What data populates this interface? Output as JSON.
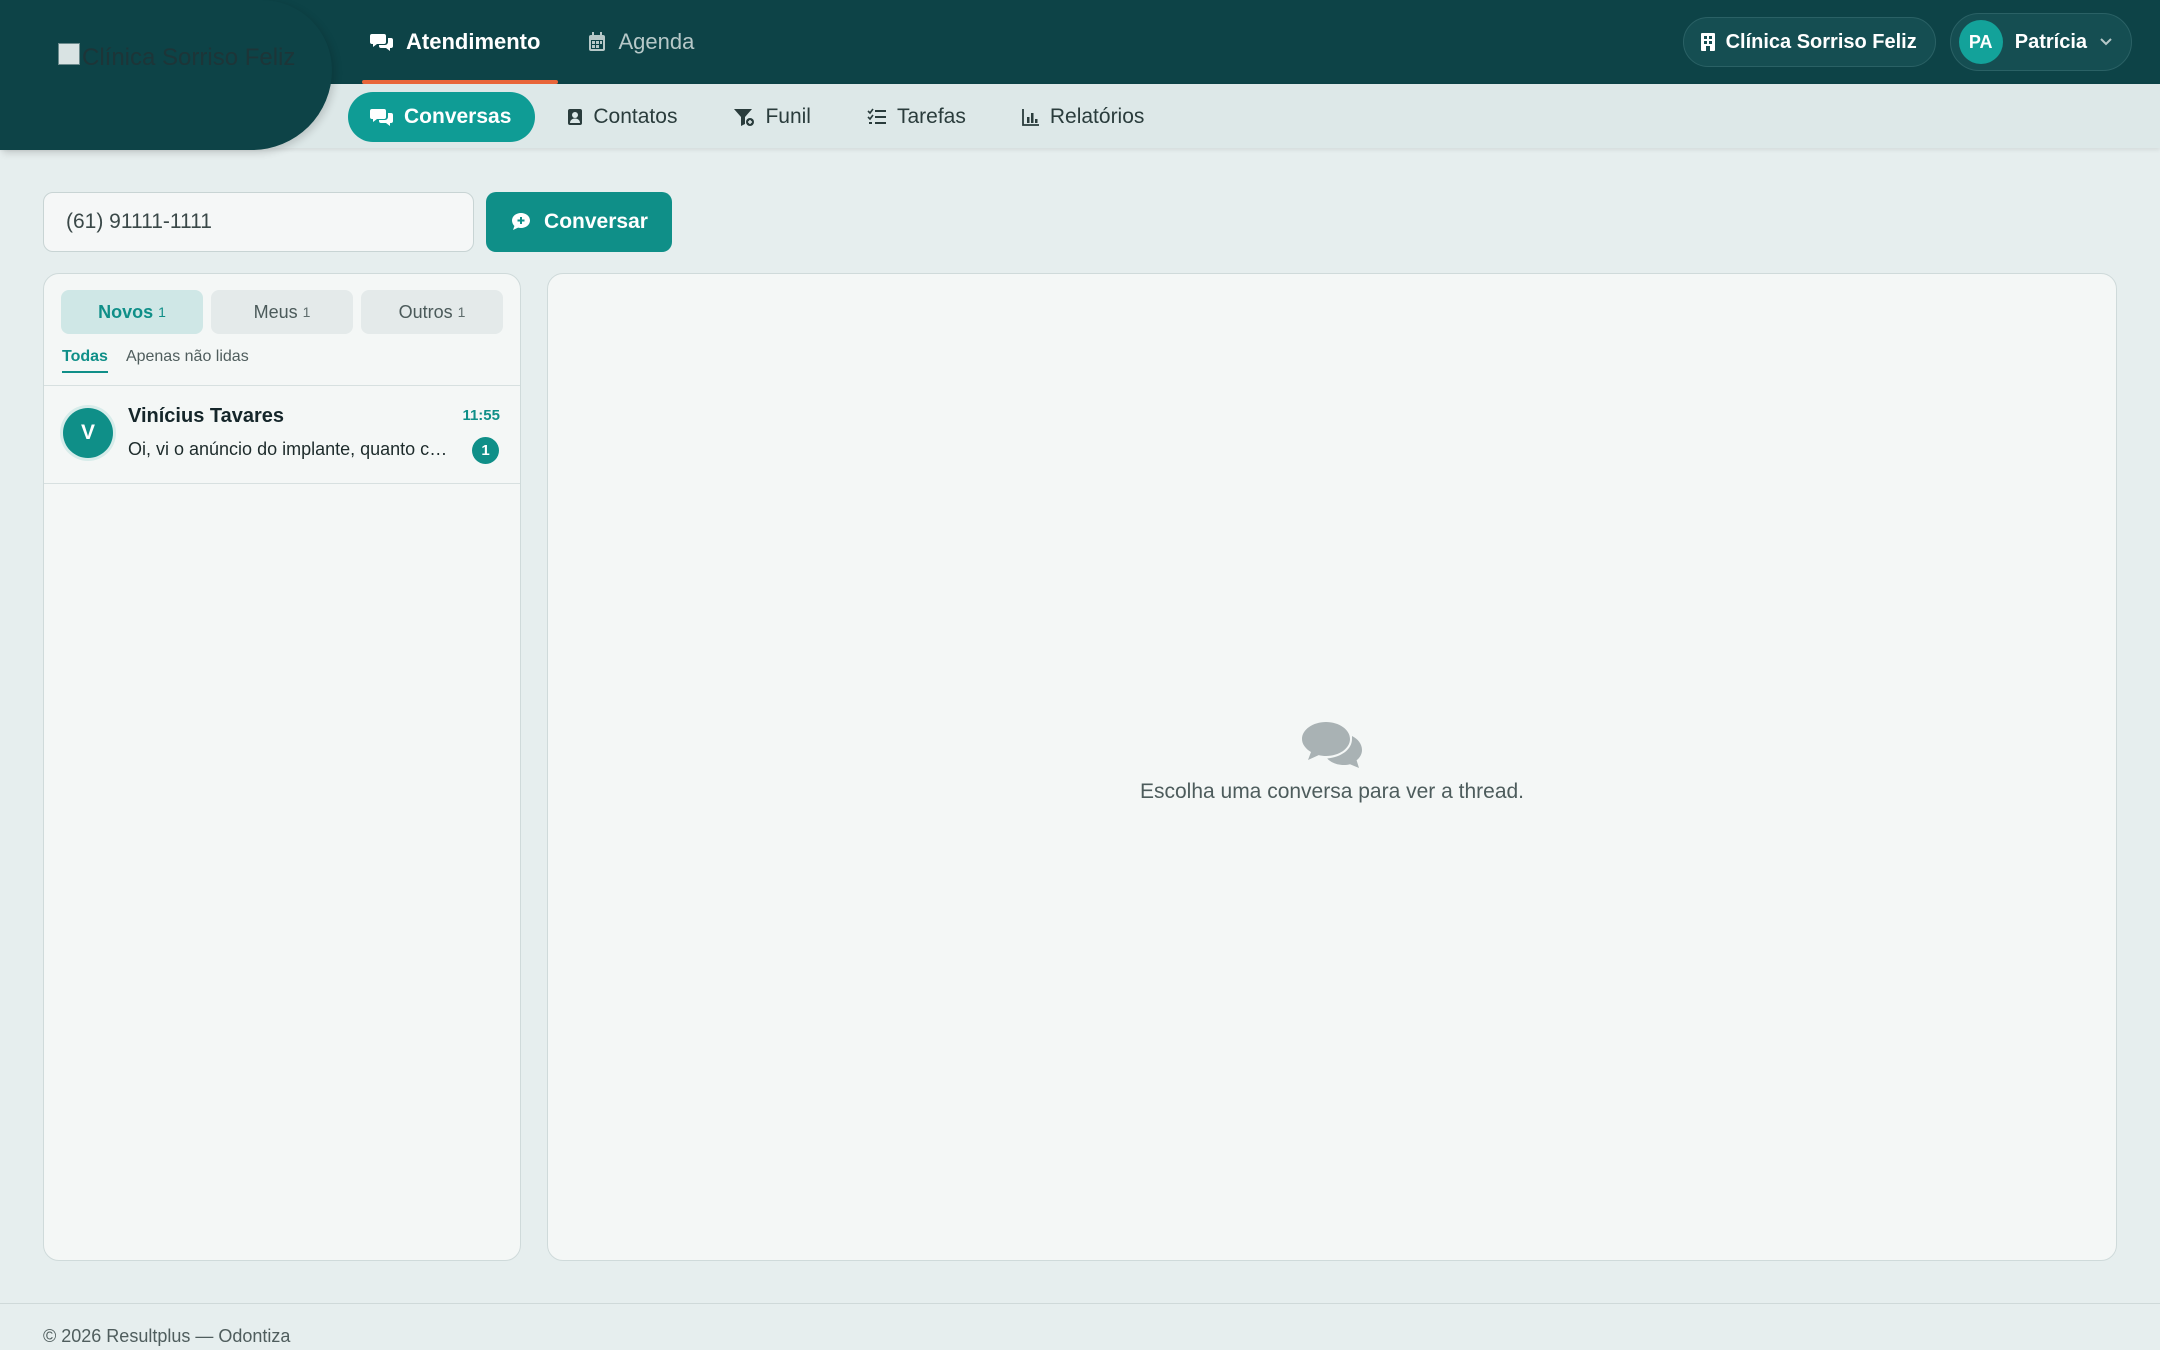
{
  "brand": {
    "logo_alt": "Clínica Sorriso Feliz"
  },
  "main_nav": {
    "items": [
      {
        "label": "Atendimento",
        "icon": "chat-bubbles-icon",
        "active": true
      },
      {
        "label": "Agenda",
        "icon": "calendar-icon",
        "active": false
      }
    ]
  },
  "header": {
    "clinic_name": "Clínica Sorriso Feliz",
    "clinic_icon": "building-icon",
    "user_initials": "PA",
    "user_name": "Patrícia",
    "user_menu_icon": "chevron-down-icon"
  },
  "sub_nav": {
    "items": [
      {
        "label": "Conversas",
        "icon": "chat-bubbles-icon",
        "active": true
      },
      {
        "label": "Contatos",
        "icon": "contact-card-icon",
        "active": false
      },
      {
        "label": "Funil",
        "icon": "funnel-icon",
        "active": false
      },
      {
        "label": "Tarefas",
        "icon": "checklist-icon",
        "active": false
      },
      {
        "label": "Relatórios",
        "icon": "bar-chart-icon",
        "active": false
      }
    ]
  },
  "search": {
    "phone_value": "(61) 91111-1111",
    "button_label": "Conversar",
    "button_icon": "chat-plus-icon"
  },
  "inbox": {
    "tabs": [
      {
        "label": "Novos",
        "count": "1",
        "active": true
      },
      {
        "label": "Meus",
        "count": "1",
        "active": false
      },
      {
        "label": "Outros",
        "count": "1",
        "active": false
      }
    ],
    "filters": [
      {
        "label": "Todas",
        "active": true
      },
      {
        "label": "Apenas não lidas",
        "active": false
      }
    ],
    "conversations": [
      {
        "avatar_initial": "V",
        "name": "Vinícius Tavares",
        "time": "11:55",
        "preview": "Oi, vi o anúncio do implante, quanto custa?",
        "unread": "1"
      }
    ]
  },
  "thread": {
    "empty_icon": "chat-bubbles-icon",
    "empty_text": "Escolha uma conversa para ver a thread."
  },
  "footer": {
    "text": "© 2026 Resultplus — Odontiza"
  },
  "colors": {
    "topbar": "#0d4347",
    "accent": "#0f8f88",
    "active_underline": "#e8653a"
  }
}
